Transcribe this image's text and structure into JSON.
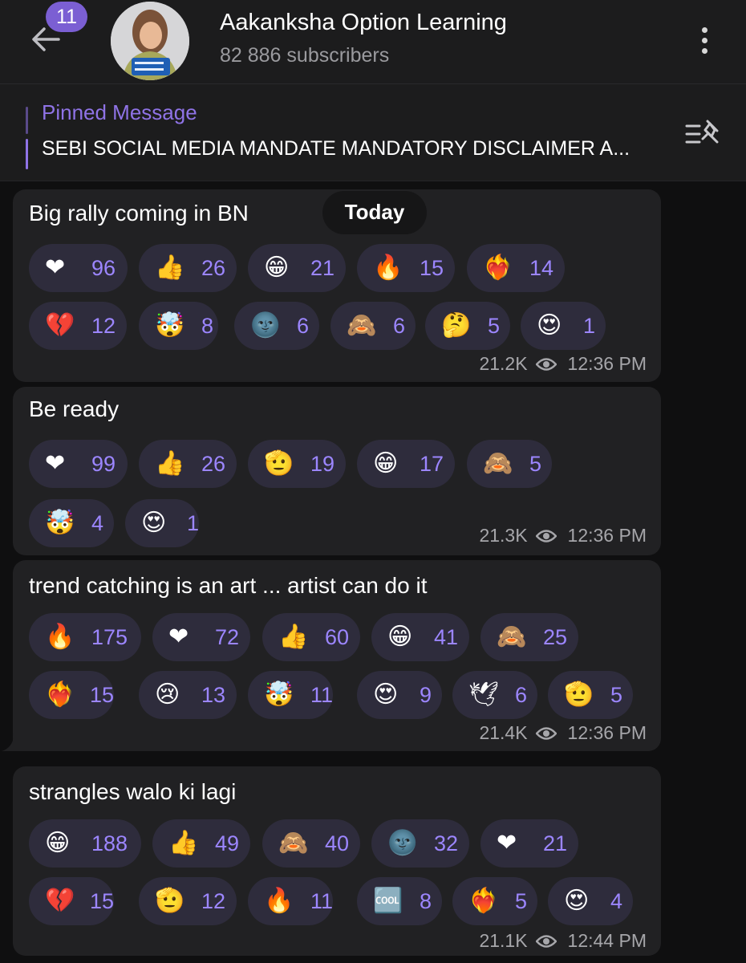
{
  "header": {
    "unread_count": "11",
    "title": "Aakanksha Option Learning",
    "subtitle": "82 886 subscribers"
  },
  "pinned": {
    "label": "Pinned Message",
    "text": "SEBI SOCIAL MEDIA MANDATE MANDATORY DISCLAIMER A..."
  },
  "date_label": "Today",
  "colors": {
    "accent": "#8f73e6",
    "reaction_bg": "#2e2c3c",
    "bubble_bg": "#212123",
    "count_text": "#9c86ff"
  },
  "messages": [
    {
      "text": "Big rally coming in BN",
      "views": "21.2K",
      "time": "12:36 PM",
      "reactions": [
        {
          "emoji": "❤",
          "icon": "red-heart-icon",
          "count": "96"
        },
        {
          "emoji": "👍",
          "icon": "thumbs-up-icon",
          "count": "26"
        },
        {
          "emoji": "😁",
          "icon": "beaming-face-icon",
          "count": "21"
        },
        {
          "emoji": "🔥",
          "icon": "fire-icon",
          "count": "15"
        },
        {
          "emoji": "❤‍🔥",
          "icon": "heart-on-fire-icon",
          "count": "14"
        },
        {
          "emoji": "💔",
          "icon": "broken-heart-icon",
          "count": "12"
        },
        {
          "emoji": "🤯",
          "icon": "exploding-head-icon",
          "count": "8"
        },
        {
          "emoji": "🌚",
          "icon": "new-moon-face-icon",
          "count": "6"
        },
        {
          "emoji": "🙈",
          "icon": "see-no-evil-monkey-icon",
          "count": "6"
        },
        {
          "emoji": "🤔",
          "icon": "thinking-face-icon",
          "count": "5"
        },
        {
          "emoji": "😍",
          "icon": "heart-eyes-icon",
          "count": "1"
        }
      ]
    },
    {
      "text": "Be ready",
      "views": "21.3K",
      "time": "12:36 PM",
      "reactions": [
        {
          "emoji": "❤",
          "icon": "red-heart-icon",
          "count": "99"
        },
        {
          "emoji": "👍",
          "icon": "thumbs-up-icon",
          "count": "26"
        },
        {
          "emoji": "🫡",
          "icon": "saluting-face-icon",
          "count": "19"
        },
        {
          "emoji": "😁",
          "icon": "beaming-face-icon",
          "count": "17"
        },
        {
          "emoji": "🙈",
          "icon": "see-no-evil-monkey-icon",
          "count": "5"
        },
        {
          "emoji": "🤯",
          "icon": "exploding-head-icon",
          "count": "4"
        },
        {
          "emoji": "😍",
          "icon": "heart-eyes-icon",
          "count": "1"
        }
      ]
    },
    {
      "text": "trend catching is an art ... artist can do it",
      "views": "21.4K",
      "time": "12:36 PM",
      "reactions": [
        {
          "emoji": "🔥",
          "icon": "fire-icon",
          "count": "175"
        },
        {
          "emoji": "❤",
          "icon": "red-heart-icon",
          "count": "72"
        },
        {
          "emoji": "👍",
          "icon": "thumbs-up-icon",
          "count": "60"
        },
        {
          "emoji": "😁",
          "icon": "beaming-face-icon",
          "count": "41"
        },
        {
          "emoji": "🙈",
          "icon": "see-no-evil-monkey-icon",
          "count": "25"
        },
        {
          "emoji": "❤‍🔥",
          "icon": "heart-on-fire-icon",
          "count": "15"
        },
        {
          "emoji": "😢",
          "icon": "crying-face-icon",
          "count": "13"
        },
        {
          "emoji": "🤯",
          "icon": "exploding-head-icon",
          "count": "11"
        },
        {
          "emoji": "😍",
          "icon": "heart-eyes-icon",
          "count": "9"
        },
        {
          "emoji": "🕊",
          "icon": "dove-icon",
          "count": "6"
        },
        {
          "emoji": "🫡",
          "icon": "saluting-face-icon",
          "count": "5"
        }
      ]
    },
    {
      "text": "strangles walo ki lagi",
      "views": "21.1K",
      "time": "12:44 PM",
      "reactions": [
        {
          "emoji": "😁",
          "icon": "beaming-face-icon",
          "count": "188"
        },
        {
          "emoji": "👍",
          "icon": "thumbs-up-icon",
          "count": "49"
        },
        {
          "emoji": "🙈",
          "icon": "see-no-evil-monkey-icon",
          "count": "40"
        },
        {
          "emoji": "🌚",
          "icon": "new-moon-face-icon",
          "count": "32"
        },
        {
          "emoji": "❤",
          "icon": "red-heart-icon",
          "count": "21"
        },
        {
          "emoji": "💔",
          "icon": "broken-heart-icon",
          "count": "15"
        },
        {
          "emoji": "🫡",
          "icon": "saluting-face-icon",
          "count": "12"
        },
        {
          "emoji": "🔥",
          "icon": "fire-icon",
          "count": "11"
        },
        {
          "emoji": "🆒",
          "icon": "cool-button-icon",
          "count": "8"
        },
        {
          "emoji": "❤‍🔥",
          "icon": "heart-on-fire-icon",
          "count": "5"
        },
        {
          "emoji": "😍",
          "icon": "heart-eyes-icon",
          "count": "4"
        }
      ]
    }
  ]
}
